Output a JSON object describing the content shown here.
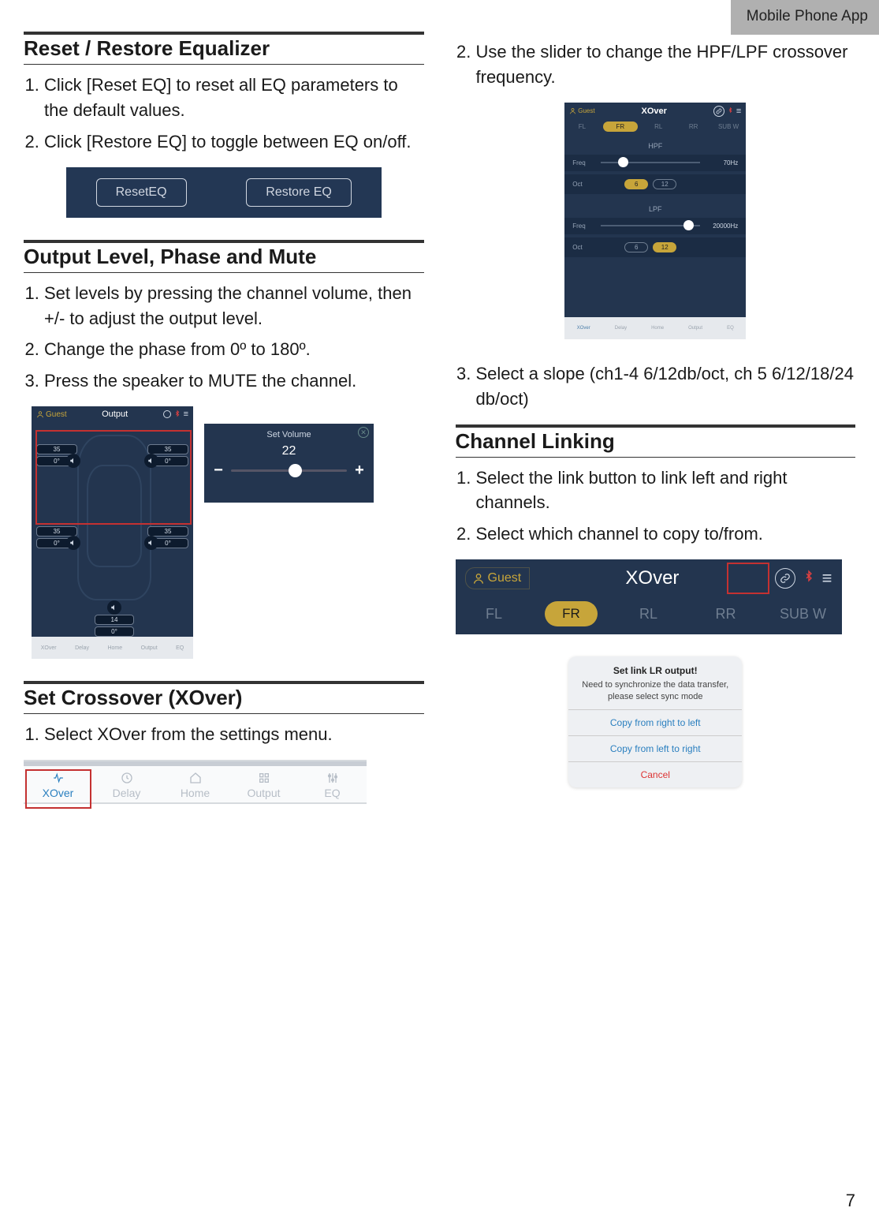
{
  "header_tab": "Mobile Phone App",
  "page_number": "7",
  "leftcol": {
    "sec1_title": "Reset / Restore Equalizer",
    "sec1_steps": [
      "Click [Reset EQ] to reset all EQ parameters to the default values.",
      "Click [Restore EQ] to toggle between EQ on/off."
    ],
    "reset_btn": "ResetEQ",
    "restore_btn": "Restore EQ",
    "sec2_title": "Output Level, Phase and Mute",
    "sec2_steps": [
      "Set levels by pressing the channel volume, then +/- to adjust the output level.",
      "Change the phase from 0º to 180º.",
      "Press the speaker to MUTE the channel."
    ],
    "output_shot": {
      "title": "Output",
      "guest": "Guest",
      "ch": {
        "val": "35",
        "phase": "0°"
      },
      "sub": {
        "val": "14",
        "phase": "0°"
      }
    },
    "volpopup": {
      "title": "Set Volume",
      "value": "22",
      "minus": "−",
      "plus": "+",
      "thumb_pct": 55
    },
    "sec3_title": "Set Crossover (XOver)",
    "sec3_steps": [
      "Select XOver from the settings menu."
    ],
    "nav_items": [
      "XOver",
      "Delay",
      "Home",
      "Output",
      "EQ"
    ]
  },
  "rightcol": {
    "step2": "Use the slider to change the HPF/LPF crossover frequency.",
    "xo_shot": {
      "title": "XOver",
      "guest": "Guest",
      "tabs": [
        "FL",
        "FR",
        "RL",
        "RR",
        "SUB W"
      ],
      "hpf_label": "HPF",
      "lpf_label": "LPF",
      "freq_label": "Freq",
      "oct_label": "Oct",
      "hpf_freq": "70Hz",
      "hpf_thumb_pct": 22,
      "hpf_oct": [
        "6",
        "12"
      ],
      "hpf_oct_active": 0,
      "lpf_freq": "20000Hz",
      "lpf_thumb_pct": 88,
      "lpf_oct": [
        "6",
        "12"
      ],
      "lpf_oct_active": 1,
      "bottom_nav": [
        "XOver",
        "Delay",
        "Home",
        "Output",
        "EQ"
      ]
    },
    "step3": "Select a slope (ch1-4 6/12db/oct, ch 5 6/12/18/24 db/oct)",
    "sec4_title": "Channel Linking",
    "sec4_steps": [
      "Select the link button to link left and right channels.",
      "Select which channel to copy to/from."
    ],
    "cl_shot": {
      "guest": "Guest",
      "title": "XOver",
      "tabs": [
        "FL",
        "FR",
        "RL",
        "RR",
        "SUB W"
      ]
    },
    "link_dialog": {
      "title": "Set link LR output!",
      "sub": "Need to synchronize the data transfer, please select sync mode",
      "opt1": "Copy from right to left",
      "opt2": "Copy from left to right",
      "cancel": "Cancel"
    }
  }
}
